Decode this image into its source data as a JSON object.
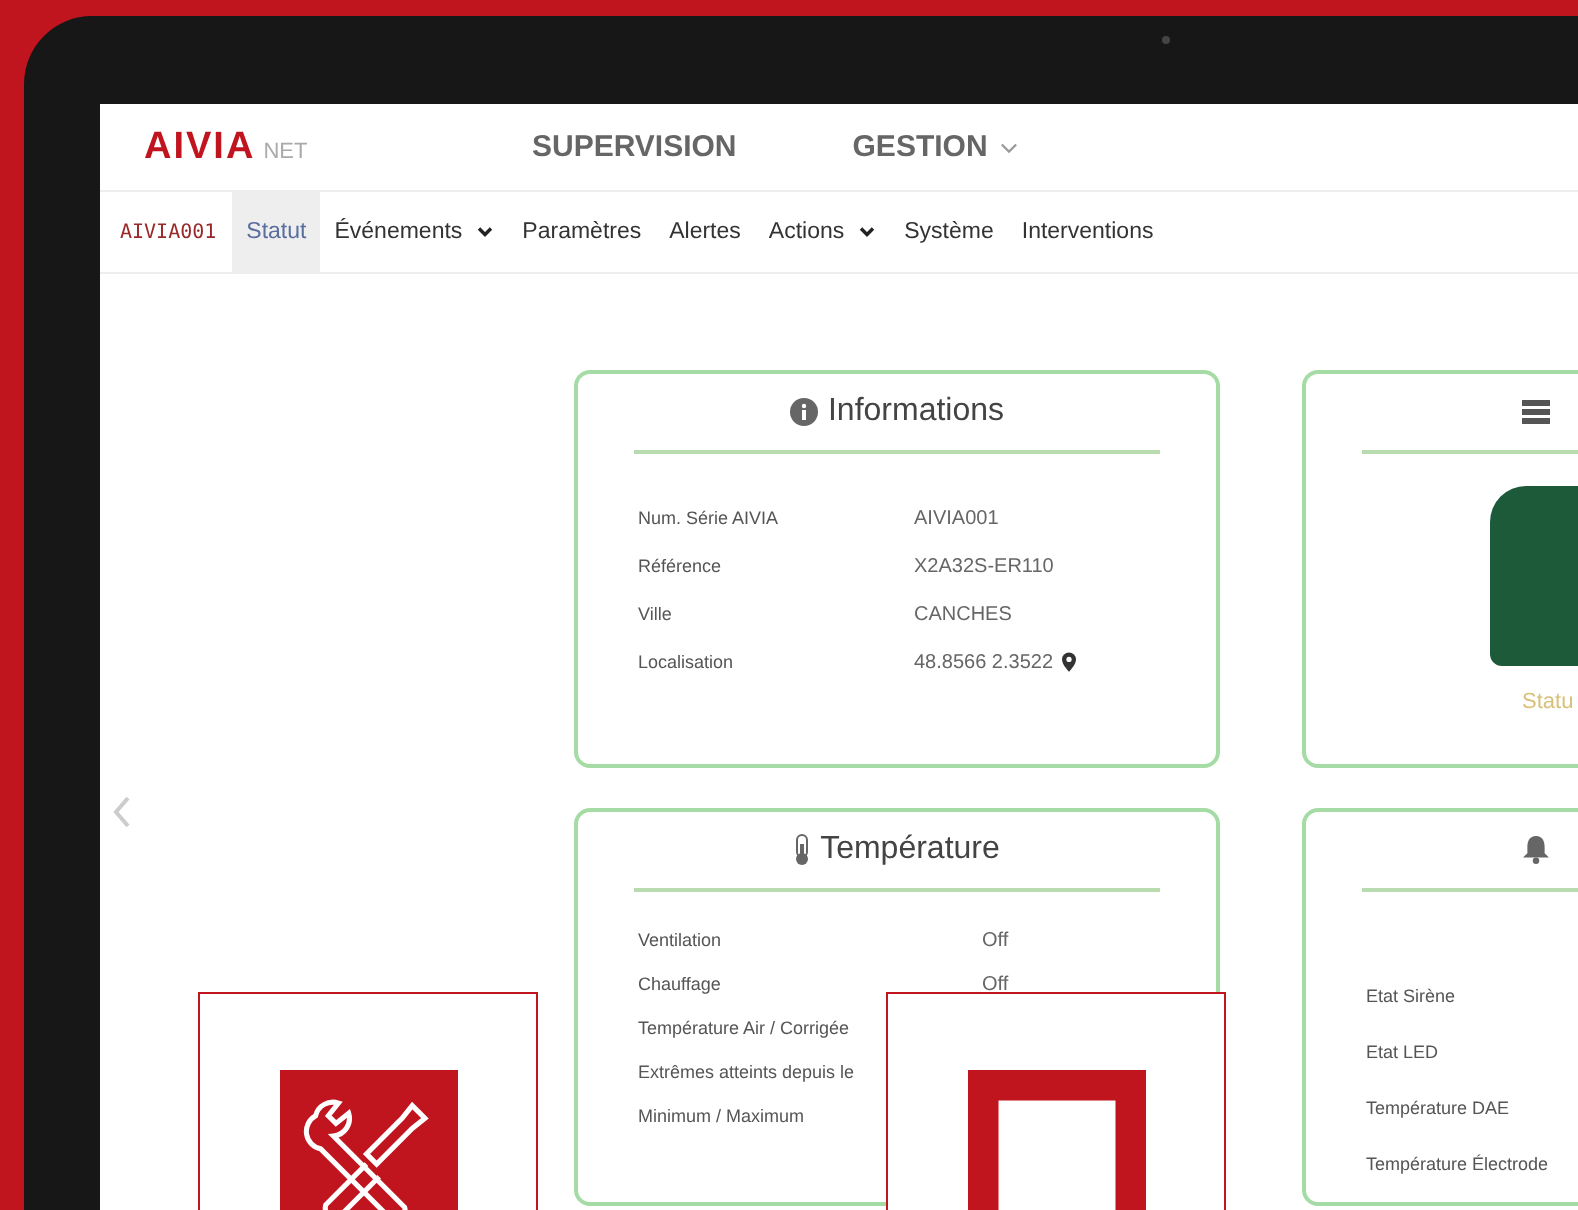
{
  "header": {
    "logo": "AIVIA",
    "logo_suffix": "NET",
    "menu": [
      {
        "label": "SUPERVISION",
        "dropdown": false
      },
      {
        "label": "GESTION",
        "dropdown": true
      }
    ]
  },
  "nav": {
    "device": "AIVIA001",
    "tabs": [
      {
        "label": "Statut",
        "selected": true,
        "dropdown": false
      },
      {
        "label": "Événements",
        "selected": false,
        "dropdown": true
      },
      {
        "label": "Paramètres",
        "selected": false,
        "dropdown": false
      },
      {
        "label": "Alertes",
        "selected": false,
        "dropdown": false
      },
      {
        "label": "Actions",
        "selected": false,
        "dropdown": true
      },
      {
        "label": "Système",
        "selected": false,
        "dropdown": false
      },
      {
        "label": "Interventions",
        "selected": false,
        "dropdown": false
      }
    ]
  },
  "cards": [
    {
      "kind": "info",
      "title": "Informations",
      "rows": [
        {
          "label": "Num. Série AIVIA",
          "value": "AIVIA001"
        },
        {
          "label": "Référence",
          "value": "X2A32S-ER110"
        },
        {
          "label": "Ville",
          "value": "CANCHES"
        },
        {
          "label": "Localisation",
          "value": "48.8566 2.3522",
          "pin": true
        }
      ]
    },
    {
      "kind": "device",
      "status": "Statu"
    },
    {
      "kind": "temperature",
      "title": "Température",
      "rows": [
        {
          "label": "Ventilation",
          "value": "Off"
        },
        {
          "label": "Chauffage",
          "value": "Off"
        },
        {
          "label": "Température Air / Corrigée"
        },
        {
          "label": "Extrêmes atteints depuis le"
        },
        {
          "label": "Minimum / Maximum"
        }
      ]
    },
    {
      "kind": "alarm",
      "rows": [
        {
          "label": "Etat Sirène"
        },
        {
          "label": "Etat LED"
        },
        {
          "label": "Température DAE"
        },
        {
          "label": "Température Électrode"
        }
      ]
    }
  ],
  "overlays": [
    {
      "kind": "tools"
    },
    {
      "kind": "square"
    }
  ]
}
